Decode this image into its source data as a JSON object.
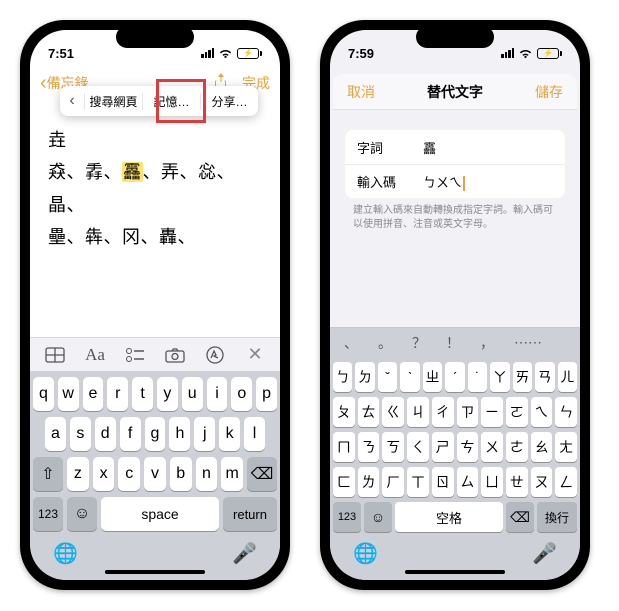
{
  "left": {
    "status": {
      "time": "7:51"
    },
    "nav": {
      "back_label": "備忘錄",
      "done_label": "完成"
    },
    "context_menu": {
      "back": "‹",
      "search_web": "搜尋網頁",
      "remember": "記憶…",
      "share": "分享…"
    },
    "note_text": {
      "line1_prefix": "垚",
      "line2_pre": "猋、掱、",
      "line2_hl": "靐",
      "line2_post": "、弄、惢、晶、",
      "line3": "壘、犇、冈、轟、"
    },
    "format_toolbar": {
      "table": "table-icon",
      "aa": "Aa",
      "checklist": "checklist-icon",
      "camera": "camera-icon",
      "markup": "markup-icon",
      "close": "✕"
    },
    "keyboard": {
      "rows": [
        [
          "q",
          "w",
          "e",
          "r",
          "t",
          "y",
          "u",
          "i",
          "o",
          "p"
        ],
        [
          "a",
          "s",
          "d",
          "f",
          "g",
          "h",
          "j",
          "k",
          "l"
        ],
        [
          "⇧",
          "z",
          "x",
          "c",
          "v",
          "b",
          "n",
          "m",
          "⌫"
        ]
      ],
      "num": "123",
      "emoji": "☺",
      "space": "space",
      "return": "return",
      "globe": "🌐",
      "mic": "🎤"
    }
  },
  "right": {
    "status": {
      "time": "7:59"
    },
    "modal": {
      "cancel": "取消",
      "title": "替代文字",
      "save": "儲存",
      "field_phrase_label": "字詞",
      "field_phrase_value": "靐",
      "field_code_label": "輸入碼",
      "field_code_value": "ㄅㄨㄟ",
      "hint": "建立輸入碼來自動轉換成指定字詞。輸入碼可以使用拼音、注音或英文字母。"
    },
    "candidates": [
      "、",
      "。",
      "？",
      "！",
      "，",
      "⋯⋯"
    ],
    "keyboard": {
      "rows": [
        [
          "ㄅ",
          "ㄉ",
          "ˇ",
          "ˋ",
          "ㄓ",
          "ˊ",
          "˙",
          "ㄚ",
          "ㄞ",
          "ㄢ",
          "ㄦ"
        ],
        [
          "ㄆ",
          "ㄊ",
          "ㄍ",
          "ㄐ",
          "ㄔ",
          "ㄗ",
          "ㄧ",
          "ㄛ",
          "ㄟ",
          "ㄣ"
        ],
        [
          "ㄇ",
          "ㄋ",
          "ㄎ",
          "ㄑ",
          "ㄕ",
          "ㄘ",
          "ㄨ",
          "ㄜ",
          "ㄠ",
          "ㄤ"
        ],
        [
          "ㄈ",
          "ㄌ",
          "ㄏ",
          "ㄒ",
          "ㄖ",
          "ㄙ",
          "ㄩ",
          "ㄝ",
          "ㄡ",
          "ㄥ"
        ]
      ],
      "num": "123",
      "emoji": "☺",
      "space": "空格",
      "return": "換行",
      "del": "⌫",
      "globe": "🌐",
      "mic": "🎤"
    }
  }
}
